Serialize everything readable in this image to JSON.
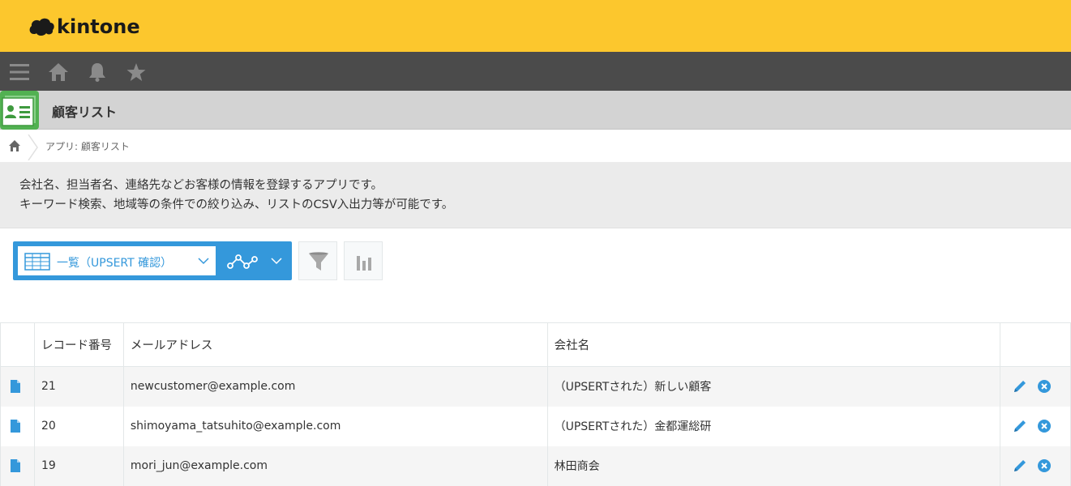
{
  "header": {
    "logo_text": "kintone",
    "brand_color": "#fcc72d"
  },
  "nav": {
    "icons": [
      "menu-icon",
      "home-icon",
      "bell-icon",
      "star-icon"
    ]
  },
  "app": {
    "title": "顧客リスト"
  },
  "breadcrumb": {
    "text": "アプリ: 顧客リスト"
  },
  "description": {
    "line1": "会社名、担当者名、連絡先などお客様の情報を登録するアプリです。",
    "line2": "キーワード検索、地域等の条件での絞り込み、リストのCSV入出力等が可能です。"
  },
  "toolbar": {
    "view_label": "一覧（UPSERT 確認）",
    "accent_color": "#3498db"
  },
  "table": {
    "headers": [
      "レコード番号",
      "メールアドレス",
      "会社名"
    ],
    "rows": [
      {
        "id": "21",
        "email": "newcustomer@example.com",
        "company": "（UPSERTされた）新しい顧客"
      },
      {
        "id": "20",
        "email": "shimoyama_tatsuhito@example.com",
        "company": "（UPSERTされた）金都運総研"
      },
      {
        "id": "19",
        "email": "mori_jun@example.com",
        "company": "林田商会"
      }
    ]
  }
}
